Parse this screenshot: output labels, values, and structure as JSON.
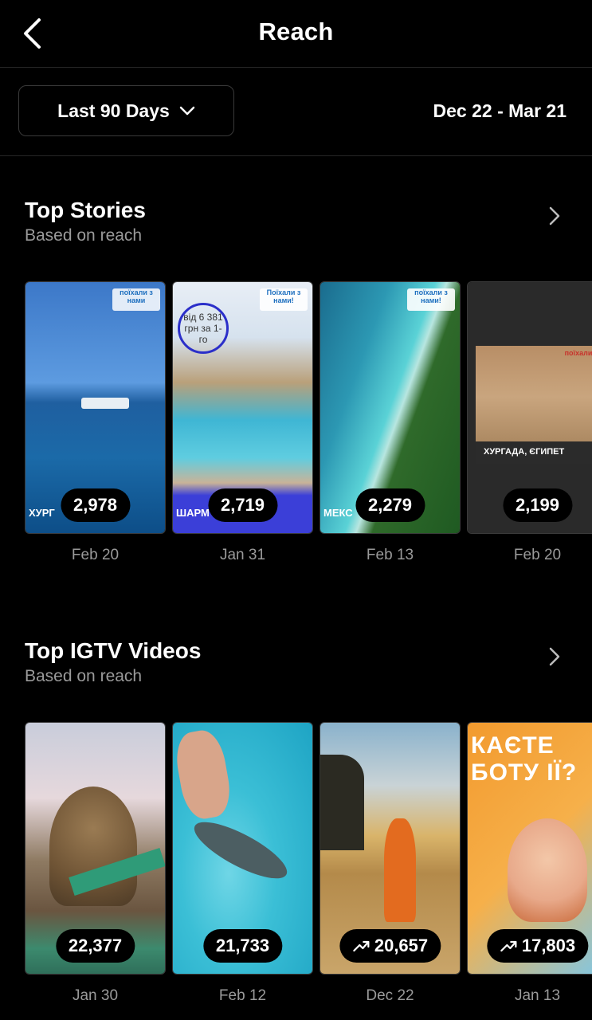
{
  "header": {
    "title": "Reach",
    "back_icon": "chevron-left-icon"
  },
  "filter": {
    "range_label": "Last 90 Days",
    "dropdown_icon": "chevron-down-icon",
    "date_range": "Dec 22 - Mar 21"
  },
  "stories": {
    "title": "Top Stories",
    "subtitle": "Based on reach",
    "items": [
      {
        "value": "2,978",
        "date": "Feb 20",
        "caption": "ХУРГ",
        "logo": "поїхали з нами"
      },
      {
        "value": "2,719",
        "date": "Jan 31",
        "caption": "ШАРМ",
        "logo": "Поїхали з нами!",
        "circle": "від 6 381 грн за 1-го"
      },
      {
        "value": "2,279",
        "date": "Feb 13",
        "caption": "МЕКС",
        "logo": "поїхали з нами!"
      },
      {
        "value": "2,199",
        "date": "Feb 20",
        "caption": "ХУРГАДА, ЄГИПЕТ",
        "logo": "поїхали"
      }
    ]
  },
  "igtv": {
    "title": "Top IGTV Videos",
    "subtitle": "Based on reach",
    "items": [
      {
        "value": "22,377",
        "date": "Jan 30",
        "trend": false
      },
      {
        "value": "21,733",
        "date": "Feb 12",
        "trend": false
      },
      {
        "value": "20,657",
        "date": "Dec 22",
        "trend": true
      },
      {
        "value": "17,803",
        "date": "Jan 13",
        "trend": true,
        "poster_text": "КАЄТЕ БОТУ ІЇ?"
      }
    ]
  },
  "colors": {
    "background": "#000000",
    "muted_text": "#9a9a9a",
    "divider": "#262626"
  }
}
